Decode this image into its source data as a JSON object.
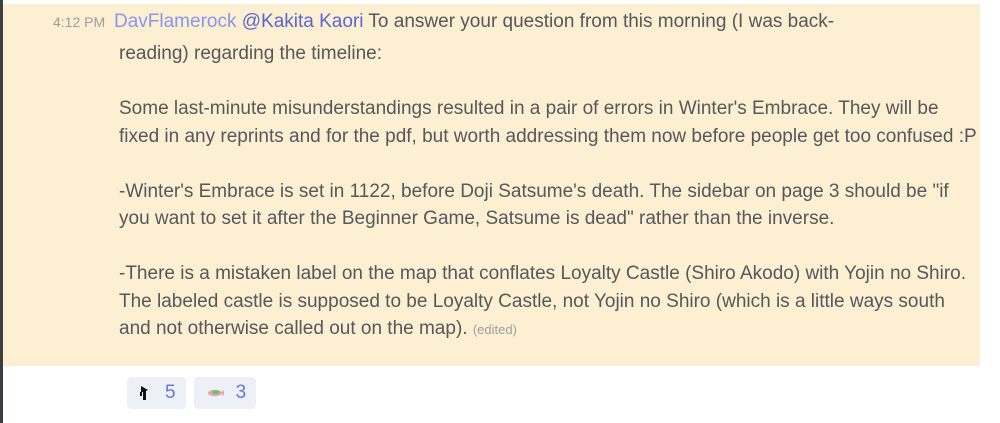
{
  "message": {
    "timestamp": "4:12 PM",
    "author": "DavFlamerock",
    "mention": "@Kakita Kaori",
    "first_line_text": " To answer your question from this morning (I was back-",
    "body_line_2": "reading) regarding the timeline:",
    "para1": "Some last-minute misunderstandings resulted in a pair of errors in Winter's Embrace. They will be fixed in any reprints and for the pdf, but worth addressing them now before people get too confused :P",
    "para2": "-Winter's Embrace is set in 1122, before Doji Satsume's death. The sidebar on page 3 should be \"if you want to set it after the Beginner Game, Satsume is dead\" rather than the inverse.",
    "para3": "-There is a mistaken label on the map that conflates Loyalty Castle (Shiro Akodo) with Yojin no Shiro. The labeled castle is supposed to be Loyalty Castle, not Yojin no Shiro (which is a little ways south and not otherwise called out on the map).",
    "edited": "(edited)"
  },
  "reactions": [
    {
      "icon": "pointing-hand-emoji",
      "count": "5"
    },
    {
      "icon": "fish-emoji",
      "count": "3"
    }
  ],
  "colors": {
    "highlight_background": "#fcefd2",
    "author": "#8c96ea",
    "mention": "#5a67cf",
    "reaction_background": "#edf0f7",
    "reaction_count": "#6a76d4"
  }
}
